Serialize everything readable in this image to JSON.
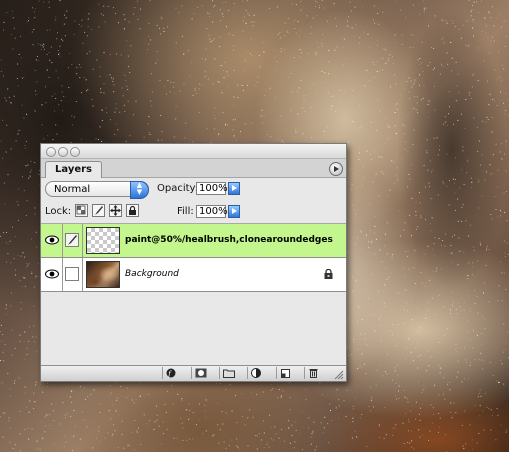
{
  "palette": {
    "tab_label": "Layers",
    "blend_mode": "Normal",
    "opacity_label": "Opacity:",
    "opacity_value": "100%",
    "lock_label": "Lock:",
    "fill_label": "Fill:",
    "fill_value": "100%",
    "selection_color": "#c3f68c",
    "layers": [
      {
        "name": "paint@50%/healbrush,clonearoundedges",
        "visible": true,
        "selected": true,
        "thumbnail": "transparent-checker"
      },
      {
        "name": "Background",
        "visible": true,
        "selected": false,
        "locked": true,
        "thumbnail": "photo"
      }
    ],
    "footer_icons": [
      "layer-style-icon",
      "layer-mask-icon",
      "new-group-icon",
      "adjustment-layer-icon",
      "new-layer-icon",
      "trash-icon"
    ]
  }
}
